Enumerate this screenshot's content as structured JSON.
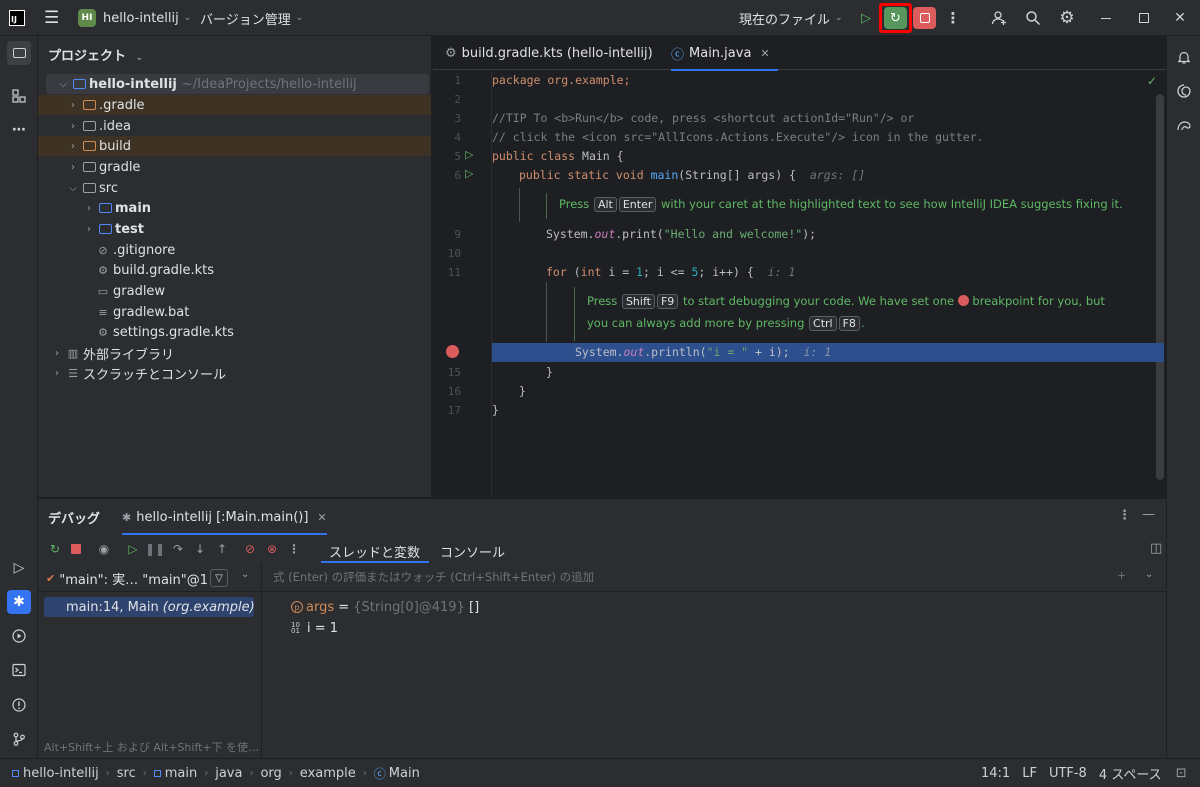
{
  "titlebar": {
    "project_badge": "HI",
    "project_name": "hello-intellij",
    "vcs": "バージョン管理",
    "run_config": "現在のファイル"
  },
  "project_panel": {
    "title": "プロジェクト",
    "tree": [
      {
        "label": "hello-intellij",
        "hint": "~/IdeaProjects/hello-intellij"
      },
      {
        "label": ".gradle"
      },
      {
        "label": ".idea"
      },
      {
        "label": "build"
      },
      {
        "label": "gradle"
      },
      {
        "label": "src"
      },
      {
        "label": "main"
      },
      {
        "label": "test"
      },
      {
        "label": ".gitignore"
      },
      {
        "label": "build.gradle.kts"
      },
      {
        "label": "gradlew"
      },
      {
        "label": "gradlew.bat"
      },
      {
        "label": "settings.gradle.kts"
      },
      {
        "label": "外部ライブラリ"
      },
      {
        "label": "スクラッチとコンソール"
      }
    ]
  },
  "editor": {
    "tabs": [
      {
        "label": "build.gradle.kts (hello-intellij)"
      },
      {
        "label": "Main.java"
      }
    ],
    "line_numbers": [
      "1",
      "2",
      "3",
      "4",
      "5",
      "6",
      "9",
      "10",
      "11",
      "15",
      "16",
      "17"
    ],
    "code": {
      "l1": "package org.example;",
      "l3": "//TIP To <b>Run</b> code, press <shortcut actionId=\"Run\"/> or",
      "l4": "// click the <icon src=\"AllIcons.Actions.Execute\"/> icon in the gutter.",
      "l5_kw": "public class",
      "l5_rest": " Main {",
      "l6_kw": "public static void",
      "l6_fn": "main",
      "l6_rest": "(String[] args) {",
      "l6_hint": "args: []",
      "l9_a": "System.",
      "l9_out": "out",
      "l9_b": ".print(",
      "l9_str": "\"Hello and welcome!\"",
      "l9_c": ");",
      "l11_for": "for",
      "l11_a": " (",
      "l11_int": "int",
      "l11_b": " i = ",
      "l11_n1": "1",
      "l11_c": "; i <= ",
      "l11_n5": "5",
      "l11_d": "; i++) {",
      "l11_hint": "i: 1",
      "l14_a": "System.",
      "l14_out": "out",
      "l14_b": ".println(",
      "l14_str": "\"i = \"",
      "l14_c": " + i);",
      "l14_hint": "i: 1",
      "l15": "}",
      "l16": "}",
      "l17": "}"
    },
    "inlay1": {
      "pre": "Press",
      "k1": "Alt",
      "k2": "Enter",
      "post": "with your caret at the highlighted text to see how IntelliJ IDEA suggests fixing it."
    },
    "inlay2": {
      "pre": "Press",
      "k1": "Shift",
      "k2": "F9",
      "mid": "to start debugging your code. We have set one",
      "post": "breakpoint for you, but",
      "line2_pre": "you can always add more by pressing",
      "k3": "Ctrl",
      "k4": "F8",
      "line2_post": "."
    }
  },
  "debug": {
    "title": "デバッグ",
    "session_tab": "hello-intellij [:Main.main()]",
    "subtabs": [
      "スレッドと変数",
      "コンソール"
    ],
    "thread_selector": "\"main\": 実… \"main\"@1",
    "frames": [
      {
        "label": "main:14, Main",
        "pkg": "(org.example)"
      }
    ],
    "frames_hint": "Alt+Shift+上 および Alt+Shift+下 を使…",
    "watch_placeholder": "式 (Enter) の評価またはウォッチ (Ctrl+Shift+Enter) の追加",
    "variables": [
      {
        "name": "args",
        "eq": " = ",
        "type": "{String[0]@419}",
        "value": " []"
      },
      {
        "name": "i",
        "eq": " = ",
        "type": "",
        "value": "1"
      }
    ]
  },
  "statusbar": {
    "breadcrumbs": [
      "hello-intellij",
      "src",
      "main",
      "java",
      "org",
      "example",
      "Main"
    ],
    "position": "14:1",
    "line_sep": "LF",
    "encoding": "UTF-8",
    "indent": "4 スペース"
  },
  "colors": {
    "accent": "#3574f0",
    "highlight_button": "#ff0000",
    "stop_button": "#db5c5c",
    "debug_button": "#57965c"
  }
}
